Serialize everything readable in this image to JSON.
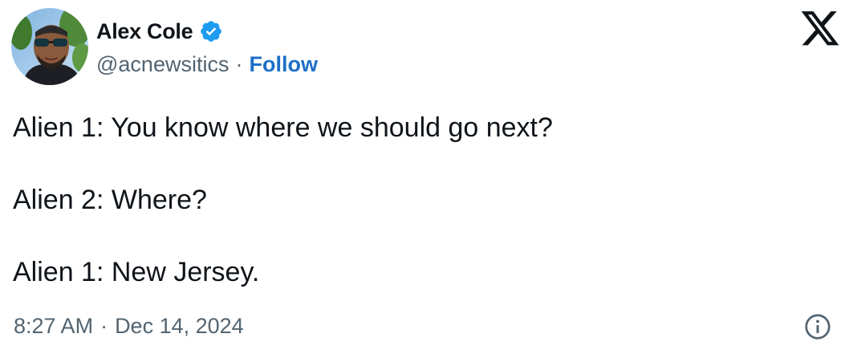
{
  "author": {
    "display_name": "Alex Cole",
    "handle": "@acnewsitics",
    "separator": "·",
    "follow_label": "Follow",
    "verified_icon": "verified-badge-icon",
    "verified_color": "#1d9bf0"
  },
  "tweet": {
    "lines": [
      "Alien 1: You know where we should go next?",
      "Alien 2: Where?",
      "Alien 1: New Jersey."
    ]
  },
  "meta": {
    "time": "8:27 AM",
    "separator": "·",
    "date": "Dec 14, 2024",
    "info_icon": "info-icon"
  },
  "colors": {
    "text": "#0f1419",
    "secondary": "#536471",
    "link": "#1d6fc7"
  },
  "icons": {
    "logo": "x-logo-icon"
  }
}
